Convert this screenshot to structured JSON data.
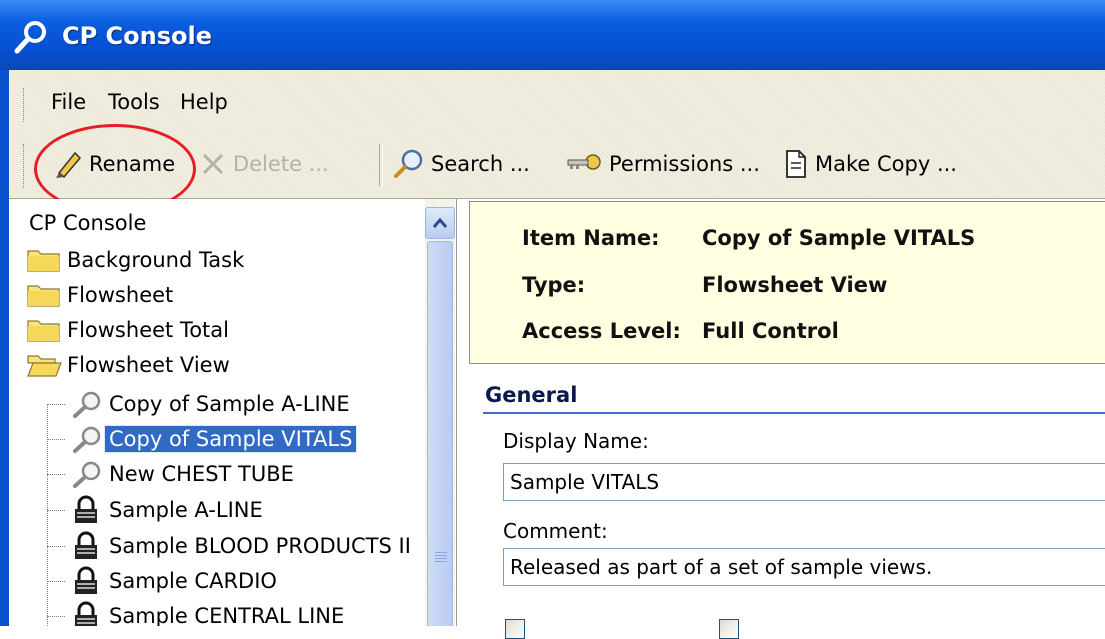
{
  "window": {
    "title": "CP Console"
  },
  "menu": [
    "File",
    "Tools",
    "Help"
  ],
  "toolbar": {
    "rename": "Rename",
    "delete": "Delete ...",
    "search": "Search ...",
    "permissions": "Permissions ...",
    "make_copy": "Make Copy ...",
    "highlight_color": "#e81d24"
  },
  "tree": {
    "root": "CP Console",
    "folders": [
      {
        "label": "Background Task",
        "icon": "folder-icon"
      },
      {
        "label": "Flowsheet",
        "icon": "folder-icon"
      },
      {
        "label": "Flowsheet Total",
        "icon": "folder-icon"
      },
      {
        "label": "Flowsheet View",
        "icon": "folder-open-icon"
      }
    ],
    "children": [
      {
        "label": "Copy of Sample A-LINE",
        "icon": "magnifier-icon"
      },
      {
        "label": "Copy of Sample VITALS",
        "icon": "magnifier-icon",
        "selected": true
      },
      {
        "label": "New CHEST TUBE",
        "icon": "magnifier-icon"
      },
      {
        "label": "Sample A-LINE",
        "icon": "lock-icon"
      },
      {
        "label": "Sample BLOOD PRODUCTS II",
        "icon": "lock-icon"
      },
      {
        "label": "Sample CARDIO",
        "icon": "lock-icon"
      },
      {
        "label": "Sample CENTRAL LINE",
        "icon": "lock-icon"
      }
    ]
  },
  "info": {
    "item_name_label": "Item Name:",
    "item_name_value": "Copy of Sample VITALS",
    "type_label": "Type:",
    "type_value": "Flowsheet View",
    "access_label": "Access Level:",
    "access_value": "Full Control"
  },
  "general": {
    "title": "General",
    "display_name_label": "Display Name:",
    "display_name_value": "Sample VITALS",
    "comment_label": "Comment:",
    "comment_value": "Released as part of a set of sample views."
  },
  "colors": {
    "titlebar": "#0a5ee0",
    "selection": "#316ac5",
    "info_bg": "#ffffe1",
    "section_rule": "#3a6fd0"
  }
}
